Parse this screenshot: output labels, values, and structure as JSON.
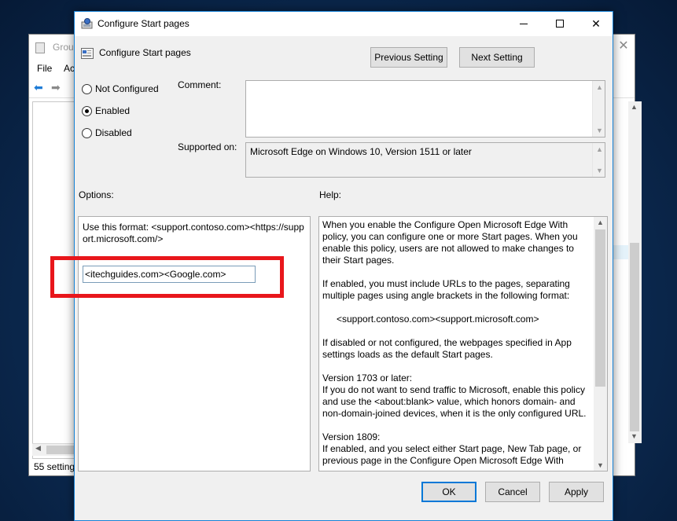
{
  "background_window": {
    "title": "Group",
    "menu": {
      "file": "File",
      "action": "Ac"
    },
    "status": "55 setting"
  },
  "dialog": {
    "title": "Configure Start pages",
    "header_title": "Configure Start pages",
    "buttons": {
      "previous": "Previous Setting",
      "next": "Next Setting",
      "ok": "OK",
      "cancel": "Cancel",
      "apply": "Apply"
    },
    "state": {
      "options": [
        "Not Configured",
        "Enabled",
        "Disabled"
      ],
      "selected": "Enabled"
    },
    "comment_label": "Comment:",
    "comment_value": "",
    "supported_label": "Supported on:",
    "supported_value": "Microsoft Edge on Windows 10, Version 1511 or later",
    "options_label": "Options:",
    "help_label": "Help:",
    "options_pane": {
      "format_text": "Use this format: <support.contoso.com><https://support.microsoft.com/>",
      "input_value": "<itechguides.com><Google.com>"
    },
    "help_paragraphs": [
      "When you enable the Configure Open Microsoft Edge With policy, you can configure one or more Start pages. When you enable this policy, users are not allowed to make changes to their Start pages.",
      "If enabled, you must include URLs to the pages, separating multiple pages using angle brackets in the following format:",
      "<support.contoso.com><support.microsoft.com>",
      "If disabled or not configured, the webpages specified in App settings loads as the default Start pages.",
      "Version 1703 or later:\nIf you do not want to send traffic to Microsoft, enable this policy and use the <about:blank> value, which honors domain- and non-domain-joined devices, when it is the only configured URL.",
      "Version 1809:\nIf enabled, and you select either Start page, New Tab page, or previous page in the Configure Open Microsoft Edge With"
    ]
  },
  "colors": {
    "highlight_box": "#e8161b",
    "accent": "#0078d7"
  }
}
